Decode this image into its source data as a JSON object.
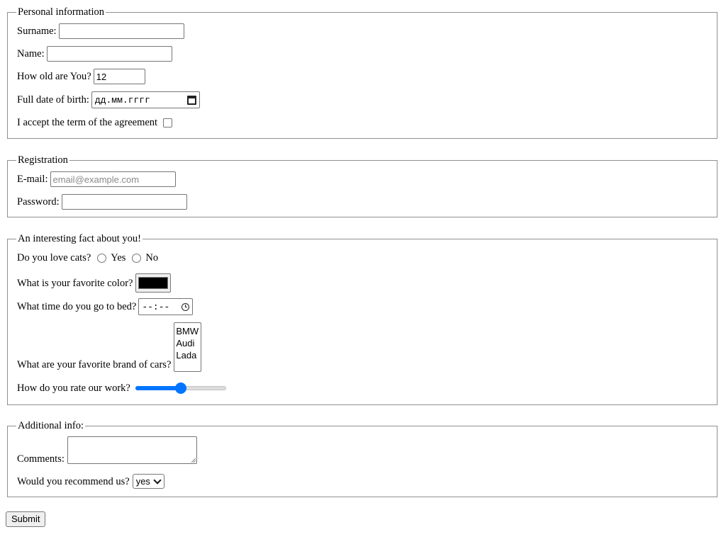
{
  "personal": {
    "legend": "Personal information",
    "surname_label": "Surname:",
    "surname_value": "",
    "name_label": "Name:",
    "name_value": "",
    "age_label": "How old are You?",
    "age_value": "12",
    "dob_label": "Full date of birth:",
    "dob_placeholder": "дд.мм.гггг",
    "agree_label": "I accept the term of the agreement",
    "agree_checked": false
  },
  "registration": {
    "legend": "Registration",
    "email_label": "E-mail:",
    "email_placeholder": "email@example.com",
    "password_label": "Password:"
  },
  "fact": {
    "legend": "An interesting fact about you!",
    "cats_label": "Do you love cats?",
    "cats_options": [
      "Yes",
      "No"
    ],
    "color_label": "What is your favorite color?",
    "color_value": "#000000",
    "bed_label": "What time do you go to bed?",
    "bed_placeholder": "--:--",
    "cars_label": "What are your favorite brand of cars?",
    "cars_options": [
      "BMW",
      "Audi",
      "Lada"
    ],
    "rate_label": "How do you rate our work?",
    "rate_fraction": 0.5
  },
  "additional": {
    "legend": "Additional info:",
    "comments_label": "Comments:",
    "recommend_label": "Would you recommend us?",
    "recommend_value": "yes"
  },
  "submit_label": "Submit",
  "colors": {
    "accent": "#0075ff",
    "border": "#8f8f8f"
  }
}
